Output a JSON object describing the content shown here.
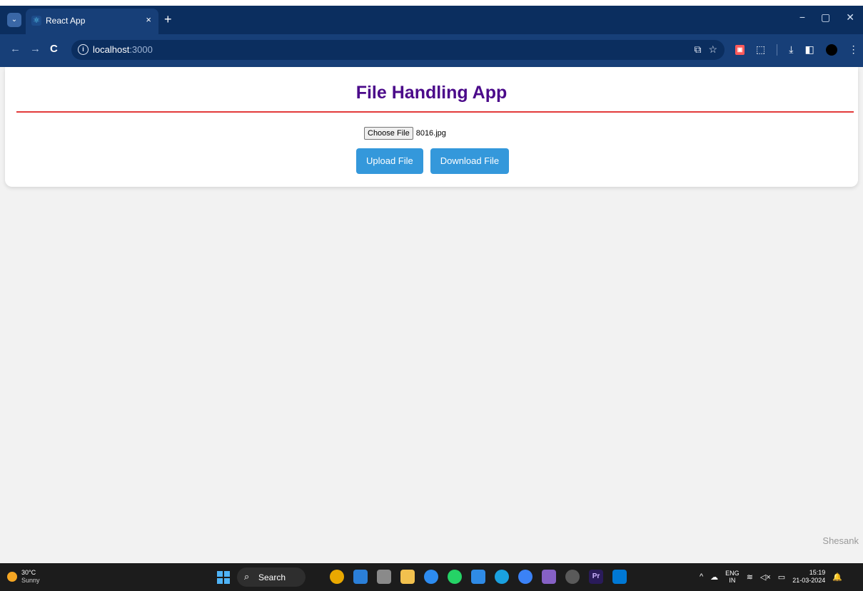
{
  "browser": {
    "tab": {
      "title": "React App",
      "close": "×"
    },
    "new_tab": "+",
    "window_controls": {
      "minimize": "−",
      "restore": "▢",
      "close": "✕"
    },
    "nav": {
      "back": "←",
      "forward": "→",
      "reload": "C"
    },
    "url_host": "localhost",
    "url_port": ":3000",
    "icons": [
      "tab-menu-icon",
      "react-favicon",
      "info-icon",
      "install-icon",
      "star-icon",
      "pdf-extension-icon",
      "extensions-icon",
      "download-icon",
      "sidebar-icon",
      "profile-avatar",
      "menu-icon"
    ]
  },
  "app": {
    "title": "File Handling App",
    "file_input": {
      "button": "Choose File",
      "selected_file": "8016.jpg"
    },
    "upload_button": "Upload File",
    "download_button": "Download File",
    "watermark": "Shesank",
    "colors": {
      "title": "#4b0a8a",
      "rule": "#e23a3a",
      "button": "#3498db"
    }
  },
  "taskbar": {
    "weather": {
      "temp": "30°C",
      "condition": "Sunny"
    },
    "search_label": "Search",
    "tray": {
      "lang_top": "ENG",
      "lang_bottom": "IN",
      "time": "15:19",
      "date": "21-03-2024"
    }
  }
}
